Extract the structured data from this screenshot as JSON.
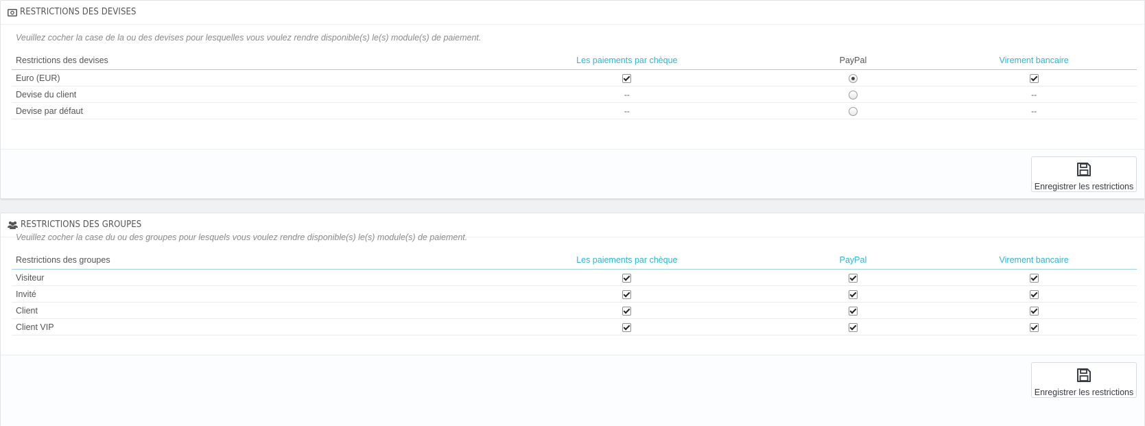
{
  "currency_panel": {
    "title": "RESTRICTIONS DES DEVISES",
    "icon": "money-icon",
    "description": "Veuillez cocher la case de la ou des devises pour lesquelles vous voulez rendre disponible(s) le(s) module(s) de paiement.",
    "columns": [
      "Restrictions des devises",
      "Les paiements par chèque",
      "PayPal",
      "Virement bancaire"
    ],
    "rows": [
      {
        "label": "Euro (EUR)",
        "cheque": "checkbox-checked",
        "paypal": "radio-checked",
        "virement": "checkbox-checked"
      },
      {
        "label": "Devise du client",
        "cheque": "--",
        "paypal": "radio-unchecked",
        "virement": "--"
      },
      {
        "label": "Devise par défaut",
        "cheque": "--",
        "paypal": "radio-unchecked",
        "virement": "--"
      }
    ],
    "save_label": "Enregistrer les restrictions"
  },
  "group_panel": {
    "title": "RESTRICTIONS DES GROUPES",
    "icon": "users-icon",
    "description": "Veuillez cocher la case du ou des groupes pour lesquels vous voulez rendre disponible(s) le(s) module(s) de paiement.",
    "columns": [
      "Restrictions des groupes",
      "Les paiements par chèque",
      "PayPal",
      "Virement bancaire"
    ],
    "rows": [
      {
        "label": "Visiteur",
        "cheque": true,
        "paypal": true,
        "virement": true
      },
      {
        "label": "Invité",
        "cheque": true,
        "paypal": true,
        "virement": true
      },
      {
        "label": "Client",
        "cheque": true,
        "paypal": true,
        "virement": true
      },
      {
        "label": "Client VIP",
        "cheque": true,
        "paypal": true,
        "virement": true
      }
    ],
    "save_label": "Enregistrer les restrictions"
  },
  "colors": {
    "link_header": "#25b9d7",
    "header_underline": "#a0d0eb",
    "background": "#eff1f2"
  }
}
